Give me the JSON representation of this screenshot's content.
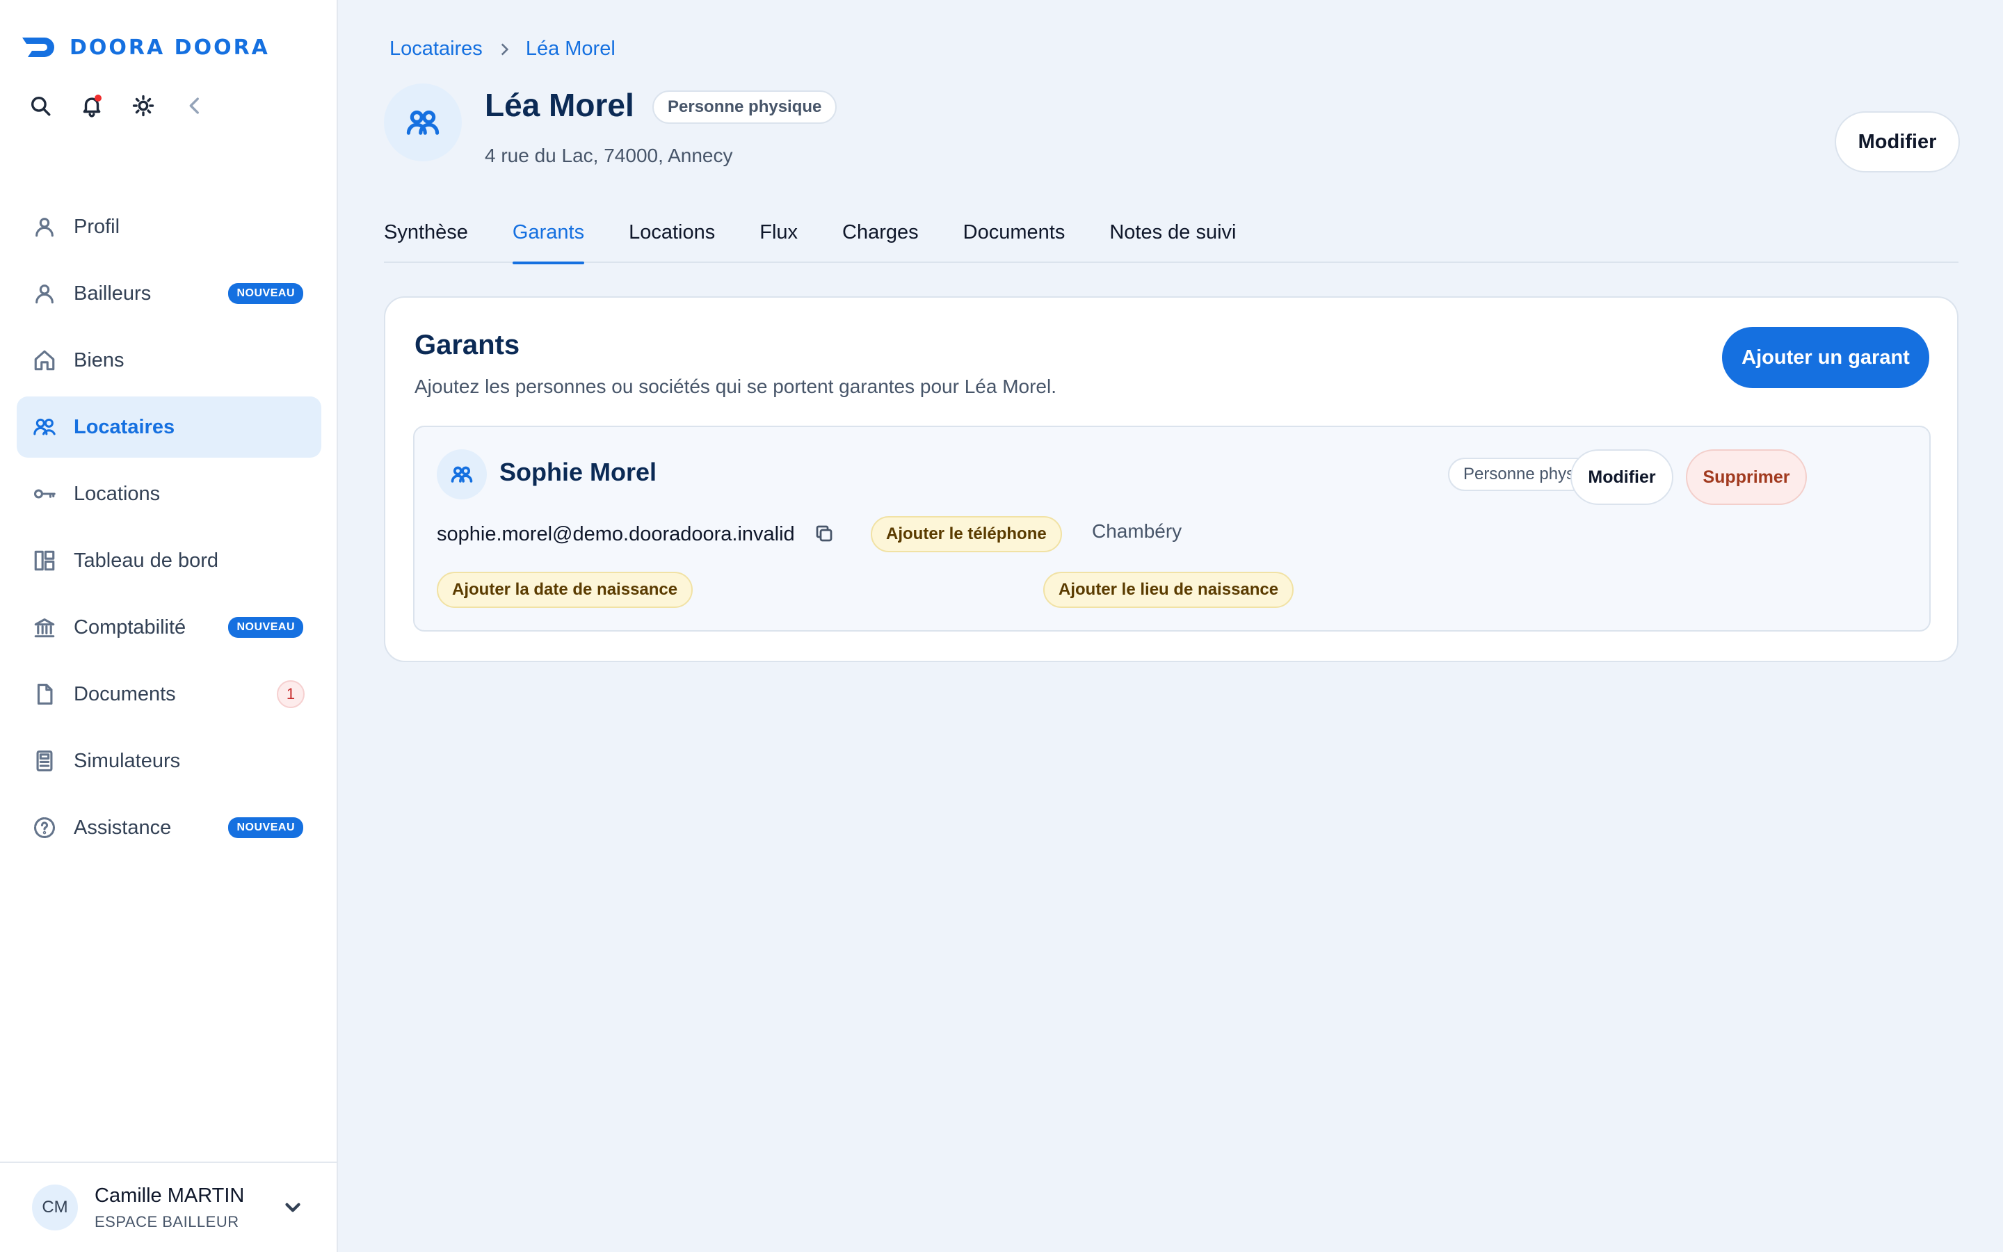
{
  "app": {
    "logo_text": "DOORA DOORA",
    "brand_color": "#1570e0"
  },
  "toolbar": {
    "icons": [
      "search-icon",
      "bell-icon",
      "sun-icon",
      "collapse-chevron-icon"
    ],
    "notification_dot": true
  },
  "sidebar": {
    "items": [
      {
        "label": "Profil",
        "icon": "user-icon"
      },
      {
        "label": "Bailleurs",
        "icon": "user-icon",
        "badge": "NOUVEAU"
      },
      {
        "label": "Biens",
        "icon": "home-icon"
      },
      {
        "label": "Locataires",
        "icon": "users-icon",
        "active": true
      },
      {
        "label": "Locations",
        "icon": "key-icon"
      },
      {
        "label": "Tableau de bord",
        "icon": "dashboard-icon"
      },
      {
        "label": "Comptabilité",
        "icon": "bank-icon",
        "badge": "NOUVEAU"
      },
      {
        "label": "Documents",
        "icon": "file-icon",
        "count": "1"
      },
      {
        "label": "Simulateurs",
        "icon": "calculator-icon"
      },
      {
        "label": "Assistance",
        "icon": "help-icon",
        "badge": "NOUVEAU"
      }
    ]
  },
  "user": {
    "initials": "CM",
    "name": "Camille MARTIN",
    "role": "ESPACE BAILLEUR"
  },
  "breadcrumb": {
    "parent": "Locataires",
    "current": "Léa Morel"
  },
  "header": {
    "name": "Léa Morel",
    "type": "Personne physique",
    "address": "4 rue du Lac, 74000, Annecy",
    "edit_label": "Modifier"
  },
  "tabs": [
    {
      "label": "Synthèse"
    },
    {
      "label": "Garants",
      "active": true
    },
    {
      "label": "Locations"
    },
    {
      "label": "Flux"
    },
    {
      "label": "Charges"
    },
    {
      "label": "Documents"
    },
    {
      "label": "Notes de suivi"
    }
  ],
  "guarantors_section": {
    "title": "Garants",
    "subtitle": "Ajoutez les personnes ou sociétés qui se portent garantes pour Léa Morel.",
    "add_label": "Ajouter un garant",
    "guarantor": {
      "name": "Sophie Morel",
      "type": "Personne physique",
      "edit_label": "Modifier",
      "delete_label": "Supprimer",
      "email": "sophie.morel@demo.dooradoora.invalid",
      "add_phone_label": "Ajouter le téléphone",
      "city": "Chambéry",
      "add_birthdate_label": "Ajouter la date de naissance",
      "add_birthplace_label": "Ajouter le lieu de naissance"
    }
  }
}
